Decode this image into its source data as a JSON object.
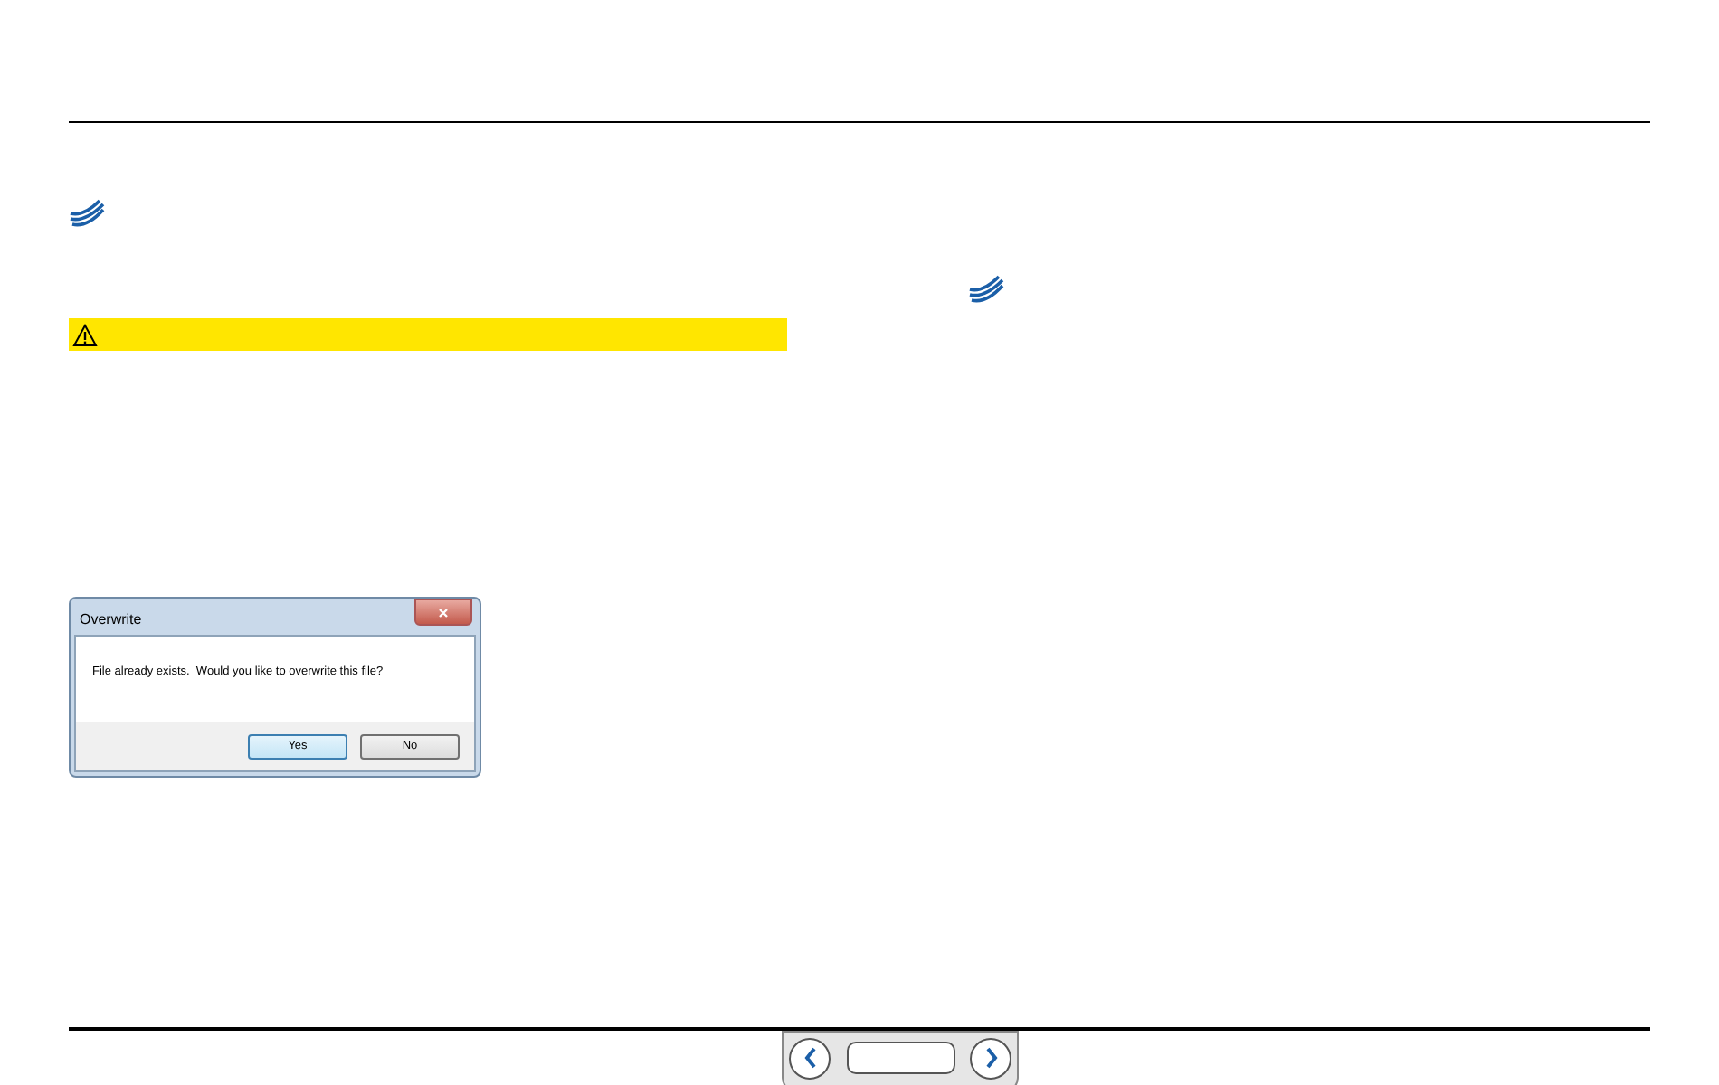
{
  "dialog": {
    "title": "Overwrite",
    "message": "File already exists.  Would you like to overwrite this file?",
    "buttons": [
      {
        "label": "Yes",
        "selected": true
      },
      {
        "label": "No",
        "selected": false
      }
    ]
  }
}
